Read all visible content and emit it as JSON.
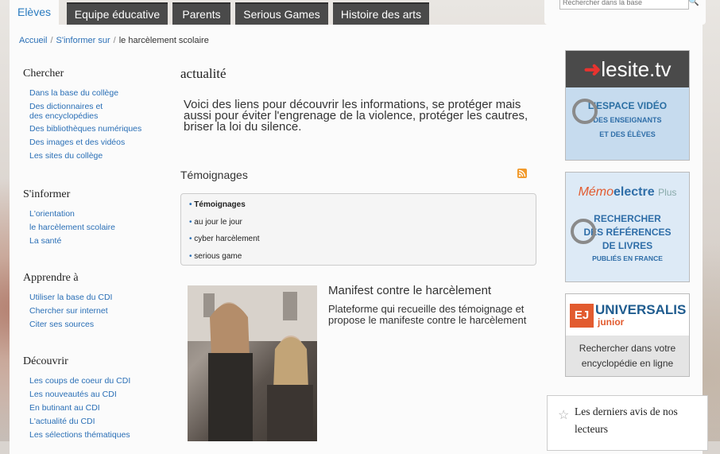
{
  "tabs": [
    {
      "label": "Elèves",
      "active": true
    },
    {
      "label": "Equipe éducative"
    },
    {
      "label": "Parents"
    },
    {
      "label": "Serious Games"
    },
    {
      "label": "Histoire des arts"
    }
  ],
  "search": {
    "placeholder": "Rechercher dans la base"
  },
  "breadcrumb": {
    "home": "Accueil",
    "level1": "S'informer sur",
    "current": "le harcèlement scolaire"
  },
  "nav": {
    "chercher": {
      "title": "Chercher",
      "items": [
        "Dans la base du collège",
        "Des dictionnaires et des encyclopédies",
        "Des bibliothèques numériques",
        "Des images et des vidéos",
        "Les sites du collège"
      ]
    },
    "informer": {
      "title": "S'informer",
      "items": [
        "L'orientation",
        "le harcèlement scolaire",
        "La santé"
      ]
    },
    "apprendre": {
      "title": "Apprendre à",
      "items": [
        "Utiliser la base du CDI",
        "Chercher sur internet",
        "Citer ses sources"
      ]
    },
    "decouvrir": {
      "title": "Découvrir",
      "items": [
        "Les coups de coeur du CDI",
        "Les nouveautés au CDI",
        "En butinant au CDI",
        "L'actualité du CDI",
        "Les sélections thématiques"
      ]
    }
  },
  "main": {
    "title": "actualité",
    "intro": "Voici des liens pour découvrir les informations, se protéger mais aussi pour éviter l'engrenage de la violence, protéger les cautres, briser la loi du silence.",
    "section_title": "Témoignages",
    "subnav": [
      "Témoignages",
      "au jour le jour",
      "cyber harcèlement",
      "serious game"
    ],
    "article": {
      "title": "Manifest contre le harcèlement",
      "text": "Plateforme qui recueille des témoignage et propose  le manifeste contre le harcèlement"
    }
  },
  "sidebar": {
    "lesite": {
      "logo_a": "le",
      "logo_b": "site.tv",
      "line1": "L'ESPACE VIDÉO",
      "line2": "DES ENSEIGNANTS",
      "line3": "ET DES ÉLÈVES"
    },
    "memo": {
      "logo_memo": "Mémo",
      "logo_electre": "electre",
      "logo_plus": "Plus",
      "line1": "RECHERCHER",
      "line2": "DES RÉFÉRENCES",
      "line3": "DE LIVRES",
      "line4": "PUBLIÉS EN FRANCE"
    },
    "universalis": {
      "ej": "EJ",
      "name": "UNIVERSALIS",
      "junior": "junior",
      "line1": "Rechercher dans votre",
      "line2": "encyclopédie en ligne"
    },
    "avis": {
      "text": "Les derniers avis de nos lecteurs"
    }
  },
  "colors": {
    "link": "#2a6fb6",
    "tab_bg": "#4a4a4a",
    "accent_red": "#e8332f",
    "rss": "#f19a2c"
  }
}
